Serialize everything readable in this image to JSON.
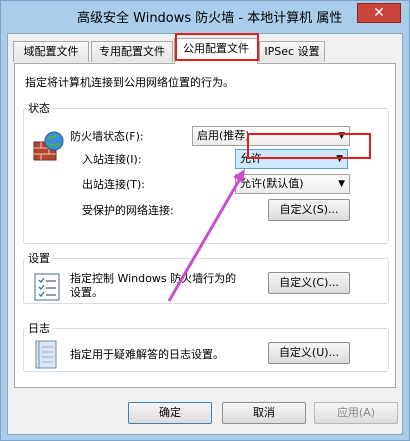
{
  "window": {
    "title": "高级安全 Windows 防火墙 - 本地计算机 属性",
    "close_label": "✕"
  },
  "tabs": [
    {
      "label": "域配置文件"
    },
    {
      "label": "专用配置文件"
    },
    {
      "label": "公用配置文件"
    },
    {
      "label": "IPSec 设置"
    }
  ],
  "panel": {
    "description": "指定将计算机连接到公用网络位置的行为。",
    "state": {
      "legend": "状态",
      "firewall_state_label": "防火墙状态(F):",
      "firewall_state_value": "启用(推荐)",
      "inbound_label": "入站连接(I):",
      "inbound_value": "允许",
      "outbound_label": "出站连接(T):",
      "outbound_value": "允许(默认值)",
      "protected_label": "受保护的网络连接:",
      "protected_button": "自定义(S)..."
    },
    "settings": {
      "legend": "设置",
      "text_line1": "指定控制 Windows 防火墙行为的",
      "text_line2": "设置。",
      "button": "自定义(C)..."
    },
    "logging": {
      "legend": "日志",
      "text": "指定用于疑难解答的日志设置。",
      "button": "自定义(U)..."
    }
  },
  "footer": {
    "ok": "确定",
    "cancel": "取消",
    "apply": "应用(A)"
  },
  "colors": {
    "highlight": "#e02020",
    "arrow": "#c94fd0"
  }
}
